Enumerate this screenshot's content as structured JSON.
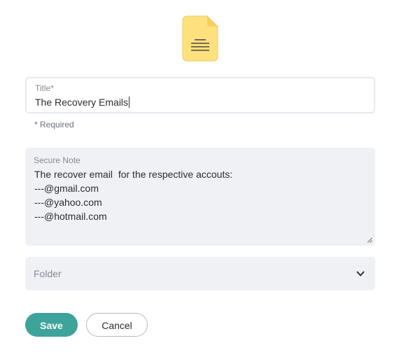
{
  "header": {
    "icon": "document-note-icon",
    "icon_color": "#fde17f"
  },
  "title_field": {
    "label": "Title*",
    "value": "The Recovery Emails",
    "hint": "* Required"
  },
  "note_field": {
    "label": "Secure Note",
    "value": "The recover email  for the respective accouts:\n---@gmail.com\n---@yahoo.com\n---@hotmail.com"
  },
  "folder_field": {
    "placeholder": "Folder",
    "icon": "chevron-down-icon"
  },
  "actions": {
    "save_label": "Save",
    "cancel_label": "Cancel",
    "accent_color": "#3ea39b"
  }
}
